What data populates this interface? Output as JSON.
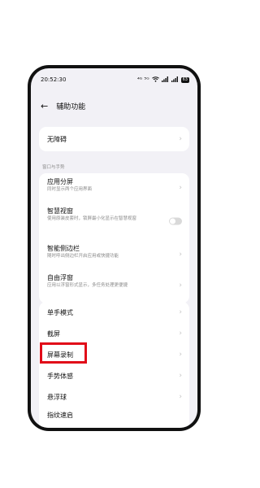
{
  "status": {
    "time": "20:52:30",
    "network": "⁴ᴳ ⁵ᴳ",
    "battery": "63"
  },
  "header": {
    "back": "←",
    "title": "辅助功能"
  },
  "card1": {
    "item": "无障碍"
  },
  "section": {
    "label": "窗口与手势"
  },
  "card2": {
    "items": [
      {
        "title": "应用分屏",
        "sub": "同时显示两个应用界面"
      },
      {
        "title": "智慧视窗",
        "sub": "使用原装皮套时，锁屏最小化显示在智慧视窗"
      },
      {
        "title": "智能侧边栏",
        "sub": "随时呼出侧边栏开启应用或快捷功能"
      },
      {
        "title": "自由浮窗",
        "sub": "应用以浮窗形式显示，多任务处理更便捷"
      }
    ]
  },
  "card3": {
    "items": [
      {
        "title": "单手模式"
      },
      {
        "title": "截屏"
      },
      {
        "title": "屏幕录制"
      },
      {
        "title": "手势体感"
      },
      {
        "title": "悬浮球"
      },
      {
        "title": "指纹速启"
      }
    ]
  },
  "icons": {
    "chevron": "›"
  }
}
